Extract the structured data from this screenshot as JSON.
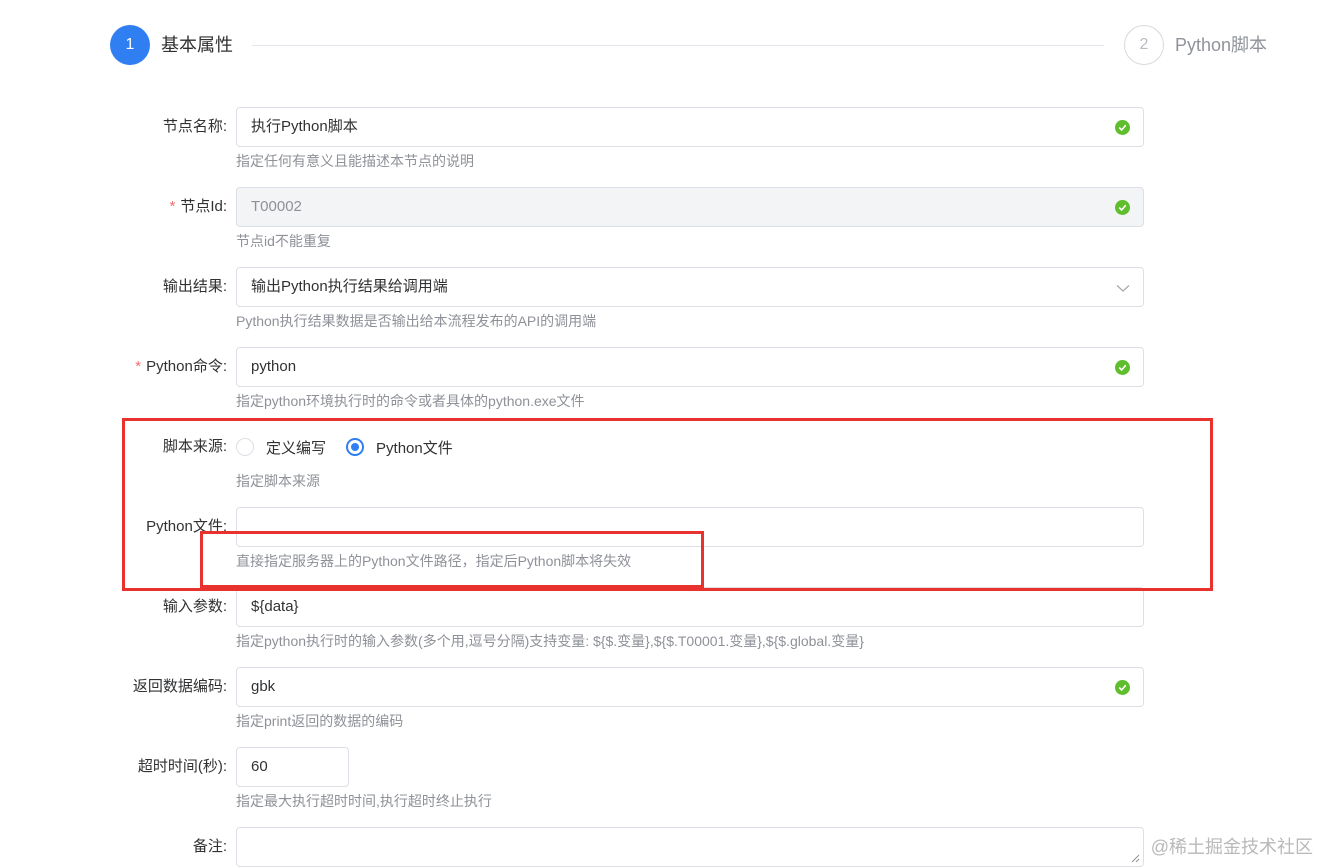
{
  "steps": [
    {
      "number": "1",
      "title": "基本属性"
    },
    {
      "number": "2",
      "title": "Python脚本"
    }
  ],
  "form": {
    "node_name": {
      "label": "节点名称:",
      "value": "执行Python脚本",
      "help": "指定任何有意义且能描述本节点的说明"
    },
    "node_id": {
      "label": "节点Id:",
      "required": "*",
      "value": "T00002",
      "help": "节点id不能重复"
    },
    "output_result": {
      "label": "输出结果:",
      "value": "输出Python执行结果给调用端",
      "help": "Python执行结果数据是否输出给本流程发布的API的调用端"
    },
    "python_cmd": {
      "label": "Python命令:",
      "required": "*",
      "value": "python",
      "help": "指定python环境执行时的命令或者具体的python.exe文件"
    },
    "script_source": {
      "label": "脚本来源:",
      "options": [
        "定义编写",
        "Python文件"
      ],
      "selected": "Python文件",
      "help": "指定脚本来源"
    },
    "python_file": {
      "label": "Python文件:",
      "value": "",
      "help": "直接指定服务器上的Python文件路径，指定后Python脚本将失效"
    },
    "input_params": {
      "label": "输入参数:",
      "value": "${data}",
      "help": "指定python执行时的输入参数(多个用,逗号分隔)支持变量: ${$.变量},${$.T00001.变量},${$.global.变量}"
    },
    "return_encoding": {
      "label": "返回数据编码:",
      "value": "gbk",
      "help": "指定print返回的数据的编码"
    },
    "timeout": {
      "label": "超时时间(秒):",
      "value": "60",
      "help": "指定最大执行超时时间,执行超时终止执行"
    },
    "remark": {
      "label": "备注:",
      "value": ""
    }
  },
  "colors": {
    "primary": "#2f7ff3",
    "success": "#5fbe2d",
    "annotation": "#e8322e"
  },
  "watermark": "@稀土掘金技术社区"
}
